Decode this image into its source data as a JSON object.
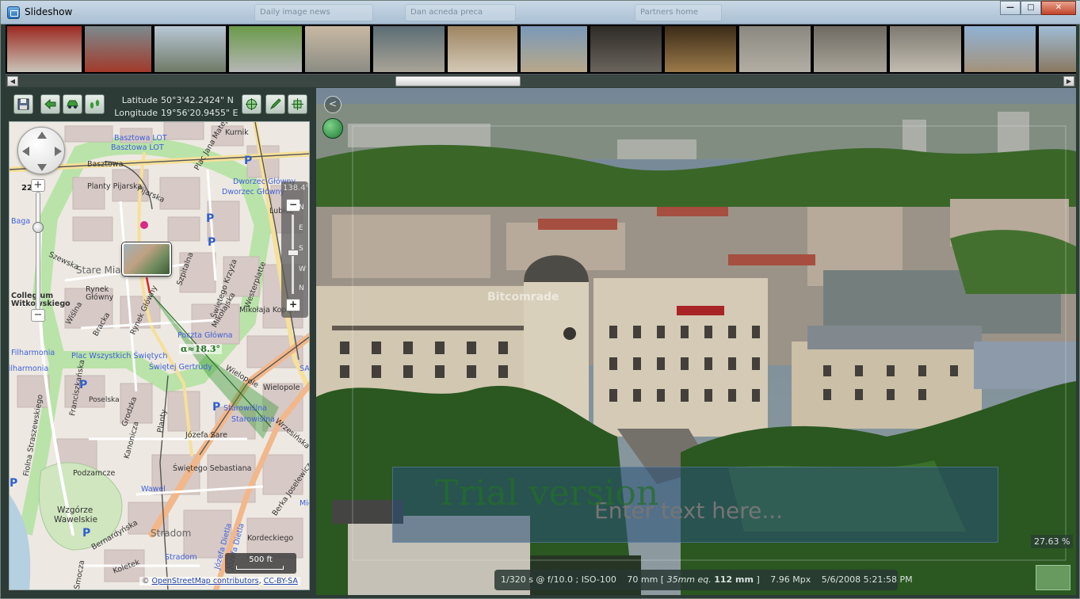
{
  "window": {
    "title": "Slideshow",
    "background_tabs": [
      "",
      "Daily image news",
      "",
      "Dan acneda preca",
      "",
      "Partners home"
    ],
    "controls": {
      "minimize": "—",
      "maximize": "□",
      "close": "✕"
    }
  },
  "filmstrip": {
    "thumbnails": [
      {
        "color_top": "#9b2a22",
        "color_bottom": "#c9c4b8"
      },
      {
        "color_top": "#7c8a8e",
        "color_bottom": "#a23a2a"
      },
      {
        "color_top": "#b8c7d6",
        "color_bottom": "#6f7a66"
      },
      {
        "color_top": "#6a9a4a",
        "color_bottom": "#b6b6b6"
      },
      {
        "color_top": "#c8b9a3",
        "color_bottom": "#8c8c84"
      },
      {
        "color_top": "#5b6d74",
        "color_bottom": "#a9a396"
      },
      {
        "color_top": "#9e8562",
        "color_bottom": "#d3c9b6"
      },
      {
        "color_top": "#7a99b8",
        "color_bottom": "#b8a88a"
      },
      {
        "color_top": "#2e2a26",
        "color_bottom": "#6a645c"
      },
      {
        "color_top": "#3b2b18",
        "color_bottom": "#9c7a4a"
      },
      {
        "color_top": "#8a8880",
        "color_bottom": "#b2aea4"
      },
      {
        "color_top": "#6e6a62",
        "color_bottom": "#aaa49a"
      },
      {
        "color_top": "#7e7a72",
        "color_bottom": "#c2bcb0"
      },
      {
        "color_top": "#8fb2d4",
        "color_bottom": "#a4927a"
      },
      {
        "color_top": "#9fbcd6",
        "color_bottom": "#8a7860"
      },
      {
        "color_top": "#a6c2dc",
        "color_bottom": "#9a8e7c"
      },
      {
        "color_top": "#5f7f4f",
        "color_bottom": "#a89c86"
      }
    ]
  },
  "geo": {
    "latitude_label": "Latitude",
    "latitude_value": "50°3'42.2424\" N",
    "longitude_label": "Longitude",
    "longitude_value": "19°56'20.9455\" E"
  },
  "toolbar": {
    "buttons": [
      "save-icon",
      "back-arrow-icon",
      "car-icon",
      "footsteps-icon",
      "crosshair-icon",
      "pen-icon",
      "square-target-icon"
    ]
  },
  "map": {
    "zoom_level": "22",
    "heading": "138.4°",
    "compass": [
      "N",
      "E",
      "S",
      "W",
      "N"
    ],
    "zoom_in": "+",
    "zoom_out": "−",
    "heading_plus": "+",
    "heading_minus": "−",
    "angle": "α≈18.3°",
    "scale": "500 ft",
    "attribution_prefix": "© ",
    "attribution_link": "OpenStreetMap contributors",
    "attribution_license": "CC-BY-SA",
    "labels": {
      "basztowa_lot_1": "Basztowa LOT",
      "basztowa_lot_2": "Basztowa LOT",
      "basztowa": "Basztowa",
      "planty_pijarska": "Planty Pijarska",
      "pijarska": "Pijarska",
      "plac_matejki": "Plac Jana Matejki",
      "kurnika": "Kurnik",
      "dworzec_1": "Dworzec Główny",
      "dworzec_2": "Dworzec Główny",
      "lubicz": "Lubicz",
      "stare_miasto": "Stare Miasto",
      "rynek": "Rynek",
      "glowny": "Główny",
      "szewska": "Szewska",
      "szpitalna": "Szpitalna",
      "swietego_krzyza": "Świętego Krzyża",
      "mikolajska": "Mikołajska",
      "westerplatte": "Westerplatte",
      "mikolaja_kop": "Mikołaja Kopern",
      "bracka": "Bracka",
      "wislna": "Wiślna",
      "poczta_glowna": "Poczta Główna",
      "plac_wszystkich": "Plac Wszystkich Świętych",
      "swietej_gertrudy": "Świętej Gertrudy",
      "filharmonia_1": "Filharmonia",
      "filharmonia_2": "Filharmonia",
      "collegium": "Collegium",
      "witkowskiego": "Witkowskiego",
      "franciszkanska": "Franciszkańska",
      "poselska": "Poselska",
      "grodzka": "Grodzka",
      "starowislna_1": "Starowiślna",
      "starowislna_2": "Starowiślna",
      "wielopole": "Wielopole",
      "wielopole_2": "Wielopole",
      "planty": "Planty",
      "kanonicza": "Kanonicza",
      "jozefa_sarego": "Józefa Sare",
      "swietego_sebastiana": "Świętego Sebastiana",
      "wrzesinska": "Wrzesińska",
      "podzamcze": "Podzamcze",
      "wawel": "Wawel",
      "wzgorze": "Wzgórze",
      "wawelskie": "Wawelskie",
      "bernardynska": "Bernardyńska",
      "stradom": "Stradom",
      "stradom_2": "Stradom",
      "jozefa_dietla_1": "Józefa Dietla",
      "jozefa_dietla_2": "Józefa Dietla",
      "koletek": "Koletek",
      "smocza": "Smocza",
      "berka_joselewicza": "Berka Joselewicza",
      "kordeckiego": "Kordeckiego",
      "fiolna": "Fiolna Straszewskiego",
      "bagatella": "Baga",
      "sa": "SA",
      "mie": "Mie",
      "rynek_glowny": "Rynek Główny"
    }
  },
  "photo": {
    "watermark": "Bitcomrade",
    "trial_text": "Trial version",
    "text_placeholder": "Enter text here...",
    "zoom": "27.63 %",
    "exif": {
      "exposure": "1/320 s @ f/10.0 ; ISO-100",
      "focal": "70 mm [",
      "eq_label": "35mm eq.",
      "eq_value": "112 mm",
      "focal_close": "]",
      "megapixels": "7.96 Mpx",
      "datetime": "5/6/2008 5:21:58 PM"
    }
  }
}
